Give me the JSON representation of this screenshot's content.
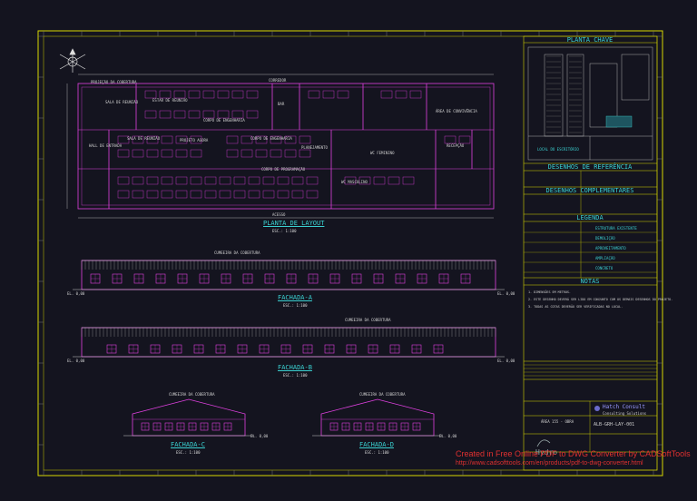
{
  "plan": {
    "title": "PLANTA DE LAYOUT",
    "scale": "ESC.: 1:100",
    "labels": [
      "PROJEÇÃO DA COBERTURA",
      "SALA DE REUNIÃO",
      "CORPO DE ENGENHARIA",
      "ESTAR DE REUNIÃO",
      "BAR",
      "CORREDOR",
      "ÁREA DE CONVIVÊNCIA",
      "HALL DE ENTRADA",
      "SALA DE REUNIÃO",
      "PROJETO AGORA",
      "CORPO DE ENGENHARIA",
      "PLANEJAMENTO",
      "CORPO DE PROGRAMAÇÃO",
      "RECEPÇÃO",
      "WC MASCULINO",
      "WC FEMININO",
      "ACESSO"
    ]
  },
  "facades": [
    {
      "title": "FACHADA-A",
      "scale": "ESC.: 1:100",
      "note": "CUMEEIRA DA COBERTURA",
      "level": "EL. 0,00"
    },
    {
      "title": "FACHADA-B",
      "scale": "ESC.: 1:100",
      "note": "CUMEEIRA DA COBERTURA",
      "level": "EL. 0,00"
    },
    {
      "title": "FACHADA-C",
      "scale": "ESC.: 1:100",
      "note": "CUMEEIRA DA COBERTURA",
      "level": "EL. 0,00"
    },
    {
      "title": "FACHADA-D",
      "scale": "ESC.: 1:100",
      "note": "CUMEEIRA DA COBERTURA",
      "level": "EL. 0,00"
    }
  ],
  "panel": {
    "key_plan_title": "PLANTA CHAVE",
    "reference_title": "DESENHOS DE REFERÊNCIA",
    "complementary_title": "DESENHOS COMPLEMENTARES",
    "legend_title": "LEGENDA",
    "notes_title": "NOTAS",
    "legend_items": [
      "ESTRUTURA EXISTENTE",
      "DEMOLIÇÃO",
      "APROVEITAMENTO",
      "AMPLIAÇÃO",
      "CONCRETO"
    ],
    "notes": [
      "1. DIMENSÕES EM METROS.",
      "2. ESTE DESENHO DEVERÁ SER LIDO EM CONJUNTO COM OS DEMAIS DESENHOS DO PROJETO.",
      "3. TODAS AS COTAS DEVERÃO SER VERIFICADAS NO LOCAL."
    ],
    "company": "Hatch Consult",
    "company_sub": "Consulting Solutions",
    "drawing_code": "ALB-GRH-LAY-001",
    "client": "Hydro",
    "project": "ÁREA 155 - OBRA",
    "key_area": "LOCAL DO ESCRITÓRIO"
  },
  "watermark": {
    "line1": "Created in Free Online PDF to DWG Converter by CADSoftTools",
    "line2": "http://www.cadsofttools.com/en/products/pdf-to-dwg-converter.html"
  },
  "colors": {
    "frame": "#d8d800",
    "wall": "#e040e0",
    "text": "#3ad0d0",
    "watermark": "#e03030"
  }
}
